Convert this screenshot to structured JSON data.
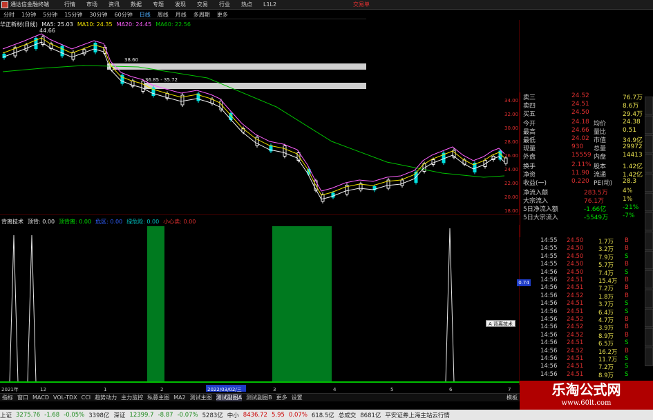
{
  "app": {
    "title": "通达信金融终端",
    "menus": [
      "行情",
      "市场",
      "资讯",
      "数据",
      "专题",
      "发现",
      "交易",
      "行业",
      "热点",
      "L1L2"
    ],
    "trade_label": "交易单"
  },
  "timebar": {
    "items": [
      "分时",
      "1分钟",
      "5分钟",
      "15分钟",
      "30分钟",
      "60分钟",
      "日线",
      "周线",
      "月线",
      "多周期",
      "更多"
    ],
    "active": "日线"
  },
  "stock": {
    "name": "华正新材(日线)",
    "ma5": "MA5: 25.03",
    "ma10": "MA10: 24.35",
    "ma20": "MA20: 24.45",
    "ma60": "MA60: 22.56",
    "high_label": "44.66",
    "zone1_label": "38.60",
    "zone2_label": "36.85 - 35.72"
  },
  "price_axis": [
    "34.00",
    "32.00",
    "30.00",
    "28.00",
    "26.00",
    "24.00",
    "22.00",
    "20.00",
    "18.00"
  ],
  "indicator": {
    "name": "背离技术",
    "fields": [
      {
        "label": "顶背: 0.00",
        "color": "#e8e8e8"
      },
      {
        "label": "顶背离: 0.00",
        "color": "#00e000"
      },
      {
        "label": "危区: 0.00",
        "color": "#3060ff"
      },
      {
        "label": "绿危险: 0.00",
        "color": "#00c0c0"
      },
      {
        "label": "小心卖: 0.00",
        "color": "#e03030"
      }
    ],
    "axis": [
      "1.00",
      "0.90",
      "0.80",
      "0.70",
      "0.60",
      "0.50",
      "0.40",
      "0.30",
      "0.20",
      "0.10"
    ],
    "cursor_value": "0.74",
    "tooltip": "A 背离技术"
  },
  "date_axis": {
    "labels": [
      "2021年",
      "12",
      "1",
      "2",
      "2022/03/02/三",
      "3",
      "4",
      "5",
      "6",
      "7"
    ]
  },
  "quote_panel": {
    "rows": [
      {
        "k1": "卖三",
        "v1": "24.52",
        "v2": "76.7万"
      },
      {
        "k1": "卖四",
        "v1": "24.51",
        "v2": "8.6万"
      },
      {
        "k1": "买五",
        "v1": "24.50",
        "v2": "29.4万"
      },
      {
        "k1": "今开",
        "v1": "24.18",
        "k2": "均价",
        "v2": "24.38"
      },
      {
        "k1": "最高",
        "v1": "24.66",
        "k2": "量比",
        "v2": "0.51"
      },
      {
        "k1": "最低",
        "v1": "24.02",
        "k2": "市值",
        "v2": "34.9亿"
      },
      {
        "k1": "现量",
        "v1": "930",
        "k2": "总量",
        "v2": "29972"
      },
      {
        "k1": "外盘",
        "v1": "15559",
        "k2": "内盘",
        "v2": "14413"
      },
      {
        "k1": "换手",
        "v1": "2.11%",
        "k2": "股本",
        "v2": "1.42亿"
      },
      {
        "k1": "净资",
        "v1": "11.90",
        "k2": "流通",
        "v2": "1.42亿"
      },
      {
        "k1": "收益(一)",
        "v1": "0.220",
        "k2": "PE(动)",
        "v2": "28.3"
      },
      {
        "k1": "净流入额",
        "v1": "283.5万",
        "v2": "4%"
      },
      {
        "k1": "大宗流入",
        "v1": "76.1万",
        "v2": "1%"
      },
      {
        "k1": "5日净流入额",
        "v1": "-1.66亿",
        "v2": "-21%"
      },
      {
        "k1": "5日大宗流入",
        "v1": "-5549万",
        "v2": "-7%"
      }
    ]
  },
  "ticks": [
    {
      "t": "14:55",
      "p": "24.50",
      "v": "1.7万",
      "d": "B"
    },
    {
      "t": "14:55",
      "p": "24.50",
      "v": "3.2万",
      "d": "B"
    },
    {
      "t": "14:55",
      "p": "24.50",
      "v": "7.9万",
      "d": "S"
    },
    {
      "t": "14:55",
      "p": "24.50",
      "v": "5.7万",
      "d": "B"
    },
    {
      "t": "14:56",
      "p": "24.50",
      "v": "7.4万",
      "d": "S"
    },
    {
      "t": "14:56",
      "p": "24.51",
      "v": "15.4万",
      "d": "B"
    },
    {
      "t": "14:56",
      "p": "24.51",
      "v": "7.2万",
      "d": "B"
    },
    {
      "t": "14:56",
      "p": "24.52",
      "v": "1.8万",
      "d": "B"
    },
    {
      "t": "14:56",
      "p": "24.51",
      "v": "3.7万",
      "d": "S"
    },
    {
      "t": "14:56",
      "p": "24.51",
      "v": "6.4万",
      "d": "S"
    },
    {
      "t": "14:56",
      "p": "24.52",
      "v": "4.7万",
      "d": "B"
    },
    {
      "t": "14:56",
      "p": "24.52",
      "v": "3.9万",
      "d": "B"
    },
    {
      "t": "14:56",
      "p": "24.52",
      "v": "8.9万",
      "d": "B"
    },
    {
      "t": "14:56",
      "p": "24.51",
      "v": "6.5万",
      "d": "S"
    },
    {
      "t": "14:56",
      "p": "24.52",
      "v": "16.2万",
      "d": "B"
    },
    {
      "t": "14:56",
      "p": "24.51",
      "v": "11.7万",
      "d": "S"
    },
    {
      "t": "14:56",
      "p": "24.51",
      "v": "7.2万",
      "d": "S"
    },
    {
      "t": "14:56",
      "p": "24.51",
      "v": "8.9万",
      "d": "S"
    }
  ],
  "tabs": [
    "指标",
    "窗口",
    "MACD",
    "VOL-TDX",
    "CCI",
    "趋势动力",
    "主力监控",
    "私募主图",
    "MA2",
    "测试主图",
    "测试副图A",
    "测试副图B",
    "更多",
    "设置"
  ],
  "tabs_right": "模板",
  "status": {
    "items": [
      {
        "label": "上证",
        "value": "3275.76",
        "chg": "-1.68",
        "pct": "-0.05%",
        "amt": "3398亿"
      },
      {
        "label": "深证",
        "value": "12399.7",
        "chg": "-8.87",
        "pct": "-0.07%",
        "amt": "5283亿"
      },
      {
        "label": "中小",
        "value": "8436.72",
        "chg": "5.95",
        "pct": "0.07%",
        "amt": "618.5亿"
      }
    ],
    "total_label": "总成交",
    "total": "8681亿",
    "broker": "平安证券上海主站云行情"
  },
  "watermark": {
    "big": "乐淘公式网",
    "small": "www.60lt.com"
  },
  "colors": {
    "up": "#e8e8e8",
    "down": "#00e0e0",
    "ma5": "#f0f0f0",
    "ma10": "#f0e000",
    "ma20": "#ff60ff",
    "ma60": "#00c000",
    "green_fill": "#007a1f",
    "red": "#e02020"
  }
}
